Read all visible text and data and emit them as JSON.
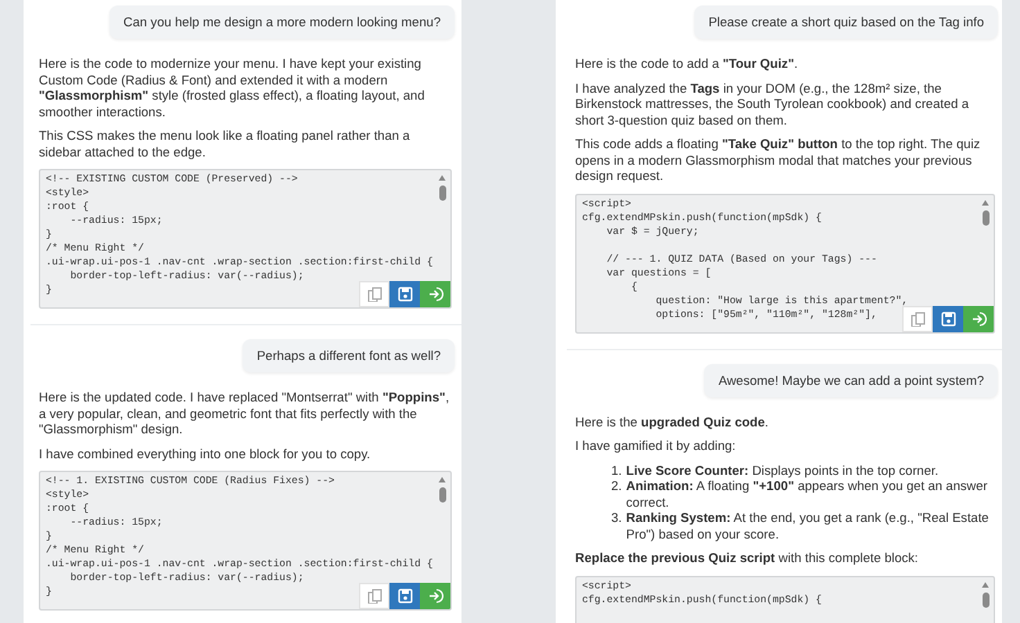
{
  "columns": [
    {
      "messages": [
        {
          "kind": "user",
          "text": "Can you help me design a more modern looking menu?"
        },
        {
          "kind": "assistant",
          "blocks": [
            {
              "kind": "paragraph",
              "text": "Here is the code to modernize your menu. I have kept your existing Custom Code (Radius & Font) and extended it with a modern **\"Glassmorphism\"** style (frosted glass effect), a floating layout, and smoother interactions."
            },
            {
              "kind": "paragraph",
              "text": "This CSS makes the menu look like a floating panel rather than a sidebar attached to the edge."
            },
            {
              "kind": "code",
              "toolbar": true,
              "lines": [
                "<!-- EXISTING CUSTOM CODE (Preserved) -->",
                "<style>",
                ":root {",
                "    --radius: 15px;",
                "}",
                "/* Menu Right */",
                ".ui-wrap.ui-pos-1 .nav-cnt .wrap-section .section:first-child {",
                "    border-top-left-radius: var(--radius);",
                "}"
              ]
            }
          ]
        },
        {
          "kind": "user",
          "text": "Perhaps a different font as well?"
        },
        {
          "kind": "assistant",
          "blocks": [
            {
              "kind": "paragraph",
              "text": "Here is the updated code. I have replaced \"Montserrat\" with **\"Poppins\"**, a very popular, clean, and geometric font that fits perfectly with the \"Glassmorphism\" design."
            },
            {
              "kind": "paragraph",
              "text": "I have combined everything into one block for you to copy."
            },
            {
              "kind": "code",
              "toolbar": true,
              "lines": [
                "<!-- 1. EXISTING CUSTOM CODE (Radius Fixes) -->",
                "<style>",
                ":root {",
                "    --radius: 15px;",
                "}",
                "/* Menu Right */",
                ".ui-wrap.ui-pos-1 .nav-cnt .wrap-section .section:first-child {",
                "    border-top-left-radius: var(--radius);",
                "}"
              ]
            }
          ]
        }
      ]
    },
    {
      "messages": [
        {
          "kind": "user",
          "text": "Please create a short quiz based on the Tag info"
        },
        {
          "kind": "assistant",
          "blocks": [
            {
              "kind": "paragraph",
              "text": "Here is the code to add a **\"Tour Quiz\"**."
            },
            {
              "kind": "paragraph",
              "text": "I have analyzed the **Tags** in your DOM (e.g., the 128m² size, the Birkenstock mattresses, the South Tyrolean cookbook) and created a short 3-question quiz based on them."
            },
            {
              "kind": "paragraph",
              "text": "This code adds a floating **\"Take Quiz\" button** to the top right. The quiz opens in a modern Glassmorphism modal that matches your previous design request."
            },
            {
              "kind": "code",
              "toolbar": true,
              "lines": [
                "<script>",
                "cfg.extendMPskin.push(function(mpSdk) {",
                "    var $ = jQuery;"
              ]
            },
            {
              "kind": "code_more",
              "lines": [
                "    // --- 1. QUIZ DATA (Based on your Tags) ---",
                "    var questions = [",
                "        {",
                "            question: \"How large is this apartment?\",",
                "            options: [\"95m²\", \"110m²\", \"128m²\"],"
              ]
            }
          ]
        },
        {
          "kind": "user",
          "text": "Awesome! Maybe we can add a point system?"
        },
        {
          "kind": "assistant",
          "blocks": [
            {
              "kind": "paragraph",
              "text": "Here is the **upgraded Quiz code**."
            },
            {
              "kind": "paragraph",
              "text": "I have gamified it by adding:"
            },
            {
              "kind": "list",
              "items": [
                {
                  "number": "1.",
                  "text": "**Live Score Counter:** Displays points in the top corner."
                },
                {
                  "number": "2.",
                  "text": "**Animation:** A floating **\"+100\"** appears when you get an answer correct."
                },
                {
                  "number": "3.",
                  "text": "**Ranking System:** At the end, you get a rank (e.g., \"Real Estate Pro\") based on your score."
                }
              ]
            },
            {
              "kind": "paragraph",
              "text": "**Replace the previous Quiz script** with this complete block:"
            },
            {
              "kind": "code",
              "lines": [
                "<script>",
                "cfg.extendMPskin.push(function(mpSdk) {"
              ]
            }
          ]
        }
      ]
    }
  ]
}
